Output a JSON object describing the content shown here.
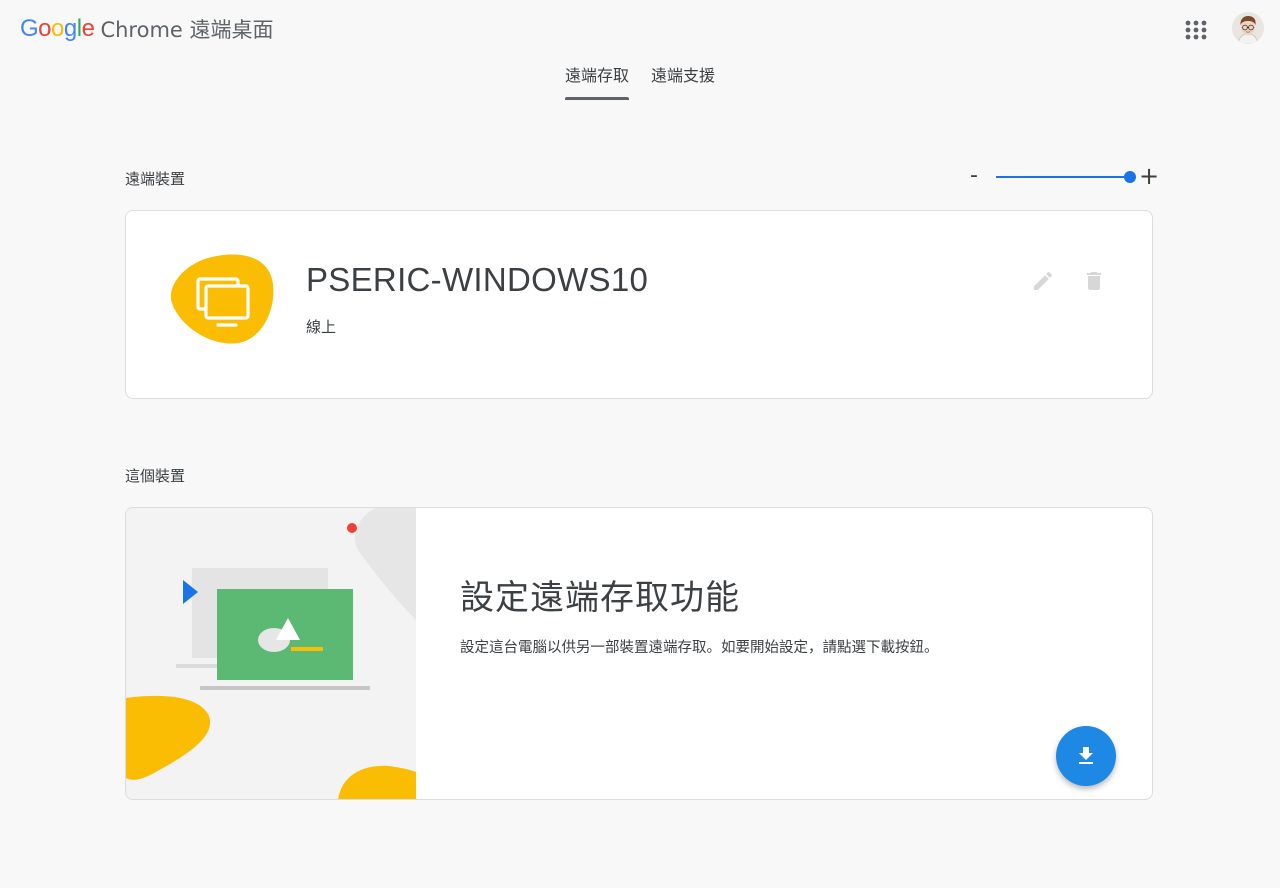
{
  "header": {
    "logo_letters": [
      {
        "ch": "G",
        "color": "#4285F4"
      },
      {
        "ch": "o",
        "color": "#EA4335"
      },
      {
        "ch": "o",
        "color": "#FBBC05"
      },
      {
        "ch": "g",
        "color": "#4285F4"
      },
      {
        "ch": "l",
        "color": "#34A853"
      },
      {
        "ch": "e",
        "color": "#EA4335"
      }
    ],
    "product_name": "Chrome 遠端桌面",
    "apps_icon": "apps-grid-icon",
    "avatar_icon": "user-avatar"
  },
  "tabs": [
    {
      "label": "遠端存取",
      "active": true
    },
    {
      "label": "遠端支援",
      "active": false
    }
  ],
  "remote_section": {
    "label": "遠端裝置",
    "zoom": {
      "minus": "-",
      "plus": "+",
      "value": 1.0
    },
    "device": {
      "name": "PSERIC-WINDOWS10",
      "status": "線上",
      "icon": "computer-icon",
      "accent": "#FBBC04"
    }
  },
  "this_section": {
    "label": "這個裝置",
    "setup_title": "設定遠端存取功能",
    "setup_desc": "設定這台電腦以供另一部裝置遠端存取。如要開始設定，請點選下載按鈕。",
    "download_icon": "download-icon",
    "fab_color": "#1E88E5"
  }
}
